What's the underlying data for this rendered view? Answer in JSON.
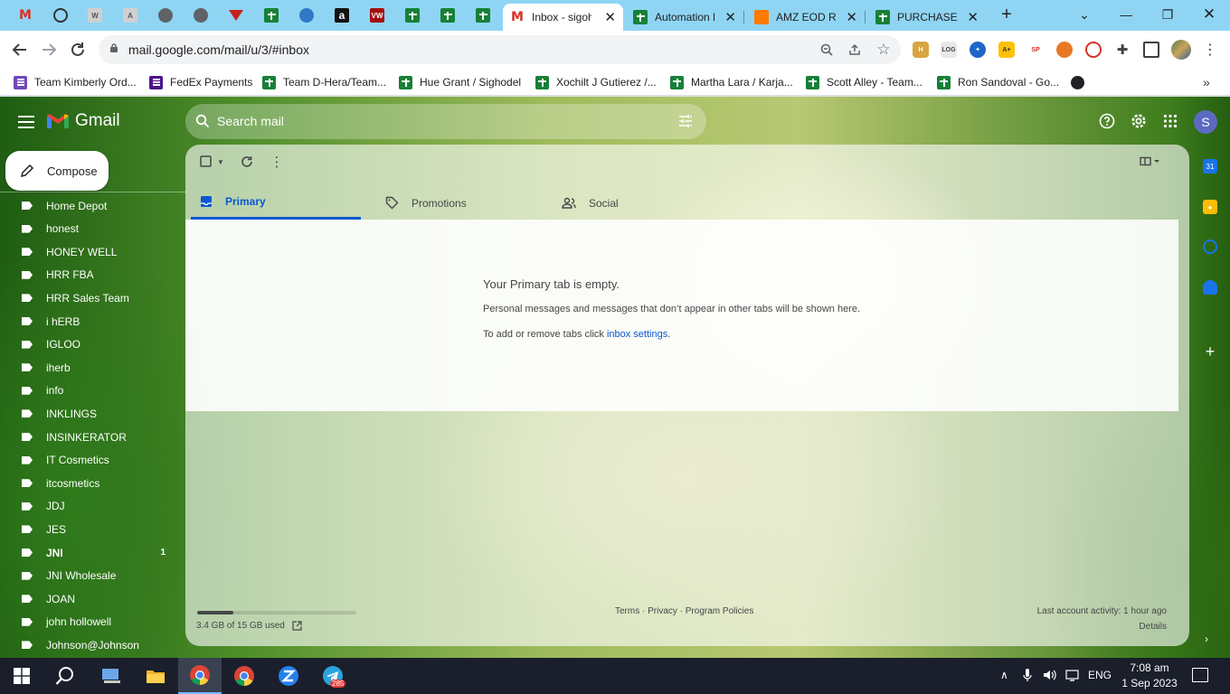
{
  "browser": {
    "tabs": [
      {
        "title": "Inbox - sigohdel",
        "active": true
      },
      {
        "title": "Automation Hub",
        "active": false
      },
      {
        "title": "AMZ EOD Report",
        "active": false
      },
      {
        "title": "PURCHASE TRACKER",
        "active": false
      }
    ],
    "url": "mail.google.com/mail/u/3/#inbox",
    "bookmarks": [
      "Team Kimberly Ord...",
      "FedEx Payments",
      "Team D-Hera/Team...",
      "Hue Grant / Sighodel",
      "Xochilt J Gutierez /...",
      "Martha Lara / Karja...",
      "Scott Alley - Team...",
      "Ron Sandoval - Go..."
    ]
  },
  "gmail": {
    "logo": "Gmail",
    "compose": "Compose",
    "search_placeholder": "Search mail",
    "account_initial": "S",
    "labels": [
      {
        "name": "Home Depot"
      },
      {
        "name": "honest"
      },
      {
        "name": "HONEY WELL"
      },
      {
        "name": "HRR FBA"
      },
      {
        "name": "HRR Sales Team"
      },
      {
        "name": "i hERB"
      },
      {
        "name": "IGLOO"
      },
      {
        "name": "iherb"
      },
      {
        "name": "info"
      },
      {
        "name": "INKLINGS"
      },
      {
        "name": "INSINKERATOR"
      },
      {
        "name": "IT Cosmetics"
      },
      {
        "name": "itcosmetics"
      },
      {
        "name": "JDJ"
      },
      {
        "name": "JES"
      },
      {
        "name": "JNI",
        "count": "1",
        "bold": true
      },
      {
        "name": "JNI Wholesale"
      },
      {
        "name": "JOAN"
      },
      {
        "name": "john hollowell"
      },
      {
        "name": "Johnson@Johnson"
      }
    ],
    "tabs": {
      "primary": "Primary",
      "promotions": "Promotions",
      "social": "Social"
    },
    "empty": {
      "title": "Your Primary tab is empty.",
      "description": "Personal messages and messages that don’t appear in other tabs will be shown here.",
      "settings_prefix": "To add or remove tabs click ",
      "settings_link": "inbox settings",
      "settings_suffix": "."
    },
    "footer": {
      "storage": "3.4 GB of 15 GB used",
      "storage_fraction": 0.227,
      "links": "Terms · Privacy · Program Policies",
      "last_activity": "Last account activity: 1 hour ago",
      "details": "Details"
    }
  },
  "taskbar": {
    "language": "ENG",
    "time": "7:08 am",
    "date": "1 Sep 2023",
    "telegram_badge": "285"
  }
}
